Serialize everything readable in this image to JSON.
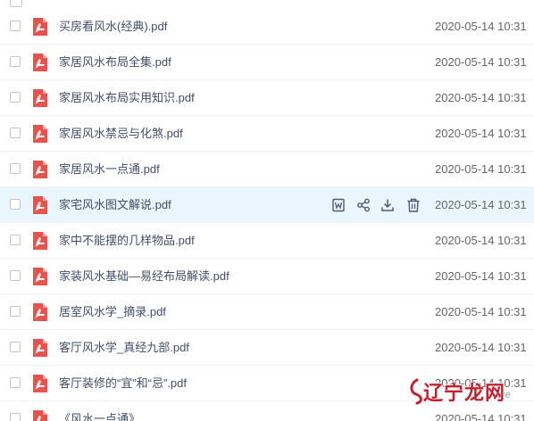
{
  "colors": {
    "hover_row": "#e9f6fd",
    "pdf_red": "#e6534e",
    "file_name": "#424e67",
    "date": "#666666",
    "watermark_red": "#c61f2e"
  },
  "rows": [
    {
      "name": "买房看风水(经典).pdf",
      "date": "2020-05-14 10:31"
    },
    {
      "name": "家居风水布局全集.pdf",
      "date": "2020-05-14 10:31"
    },
    {
      "name": "家居风水布局实用知识.pdf",
      "date": "2020-05-14 10:31"
    },
    {
      "name": "家居风水禁忌与化煞.pdf",
      "date": "2020-05-14 10:31"
    },
    {
      "name": "家居风水一点通.pdf",
      "date": "2020-05-14 10:31"
    },
    {
      "name": "家宅风水图文解说.pdf",
      "date": "2020-05-14 10:31"
    },
    {
      "name": "家中不能摆的几样物品.pdf",
      "date": "2020-05-14 10:31"
    },
    {
      "name": "家装风水基础—易经布局解读.pdf",
      "date": "2020-05-14 10:31"
    },
    {
      "name": "居室风水学_摘录.pdf",
      "date": "2020-05-14 10:31"
    },
    {
      "name": "客厅风水学_真经九部.pdf",
      "date": "2020-05-14 10:31"
    },
    {
      "name": "客厅装修的“宜”和“忌”.pdf",
      "date": "2020-05-14 10:31"
    },
    {
      "name": "《风水一点通》",
      "date": "2020-05-14 10:31"
    }
  ],
  "hover_actions": [
    {
      "icon": "word-doc-icon"
    },
    {
      "icon": "share-icon"
    },
    {
      "icon": "download-icon"
    },
    {
      "icon": "trash-icon"
    }
  ],
  "watermark": {
    "text": "辽宁龙网",
    "sub": "ure"
  }
}
